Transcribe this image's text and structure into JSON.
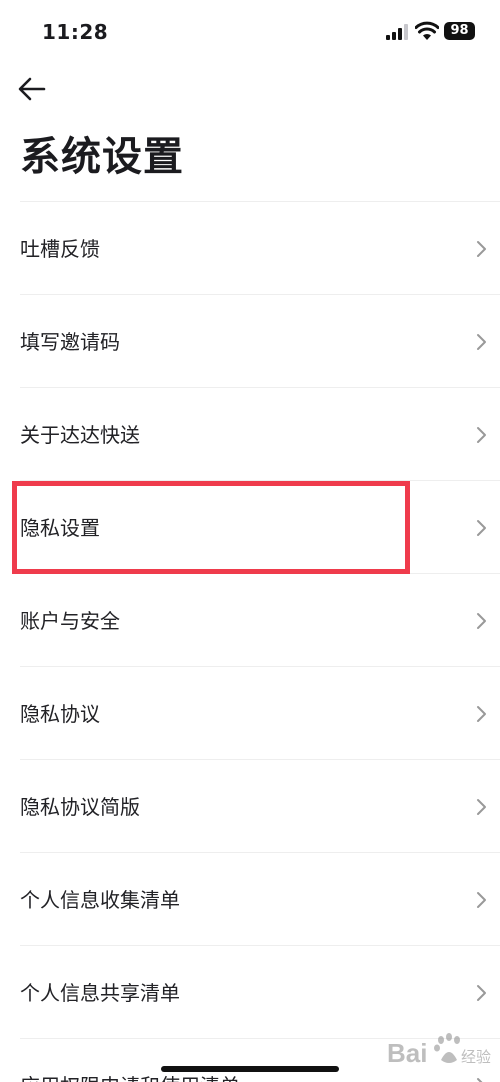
{
  "status_bar": {
    "time": "11:28",
    "battery_level": "98",
    "icons": [
      "signal-icon",
      "wifi-icon",
      "battery-icon"
    ]
  },
  "header": {
    "back_icon": "arrow-left-icon",
    "title": "系统设置"
  },
  "menu": {
    "items": [
      {
        "label": "吐槽反馈"
      },
      {
        "label": "填写邀请码"
      },
      {
        "label": "关于达达快送"
      },
      {
        "label": "隐私设置",
        "highlighted": true
      },
      {
        "label": "账户与安全"
      },
      {
        "label": "隐私协议"
      },
      {
        "label": "隐私协议简版"
      },
      {
        "label": "个人信息收集清单"
      },
      {
        "label": "个人信息共享清单"
      },
      {
        "label": "应用权限申请和使用清单"
      }
    ]
  },
  "colors": {
    "highlight": "#ef3b4c",
    "text": "#222226",
    "divider": "#eeeeee",
    "chevron": "#999999"
  },
  "watermark": {
    "brand": "Bai",
    "suffix": "经验"
  }
}
